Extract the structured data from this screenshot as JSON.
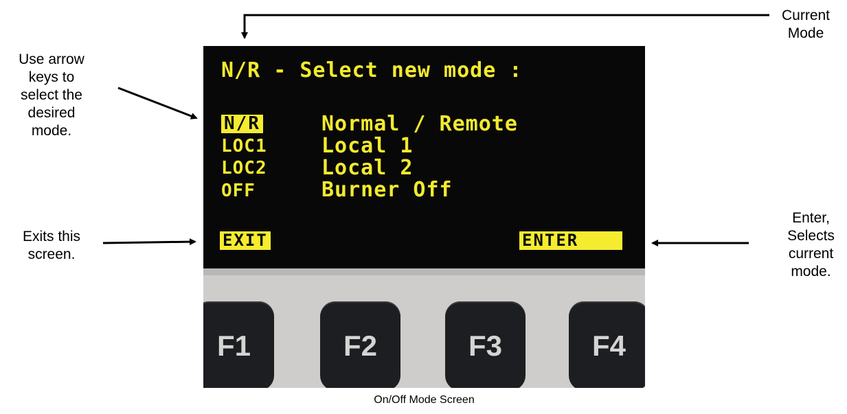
{
  "screen": {
    "title": "N/R - Select new mode :",
    "modes": [
      {
        "code": "N/R",
        "label": "Normal / Remote",
        "selected": true
      },
      {
        "code": "LOC1",
        "label": "Local 1",
        "selected": false
      },
      {
        "code": "LOC2",
        "label": "Local 2",
        "selected": false
      },
      {
        "code": "OFF",
        "label": "Burner Off",
        "selected": false
      }
    ],
    "exit_label": "EXIT",
    "enter_label": "ENTER"
  },
  "keys": [
    "F1",
    "F2",
    "F3",
    "F4"
  ],
  "annotations": {
    "current_mode": [
      "Current",
      "Mode"
    ],
    "arrow_keys": [
      "Use arrow",
      "keys to",
      "select the",
      "desired",
      "mode."
    ],
    "exits": [
      "Exits this",
      "screen."
    ],
    "enter": [
      "Enter,",
      "Selects",
      "current",
      "mode."
    ]
  },
  "caption": "On/Off Mode Screen",
  "colors": {
    "lcd_text": "#f2ea2e",
    "lcd_background": "#080808",
    "key": "#1d1e21"
  }
}
